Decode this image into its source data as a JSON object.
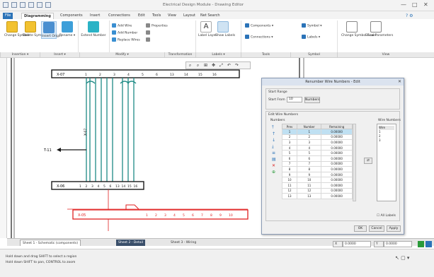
{
  "window": {
    "title": "Electrical Design Module - Drawing Editor",
    "controls": [
      "—",
      "□",
      "✕"
    ]
  },
  "ribbon_tabs": [
    {
      "label": "File"
    },
    {
      "label": "Diagramming",
      "active": true
    },
    {
      "label": "Components"
    },
    {
      "label": "Insert"
    },
    {
      "label": "Connections"
    },
    {
      "label": "Edit"
    },
    {
      "label": "Tools"
    },
    {
      "label": "View"
    },
    {
      "label": "Layout"
    },
    {
      "label": "Net Search"
    }
  ],
  "ribbon": {
    "groups": [
      {
        "label": "Insertion ▾"
      },
      {
        "label": "Insert ▾"
      },
      {
        "label": "Modify ▾"
      },
      {
        "label": "Transformation"
      },
      {
        "label": "Labels ▾"
      },
      {
        "label": "Tools"
      },
      {
        "label": "Symbol"
      },
      {
        "label": "View"
      }
    ],
    "buttons": {
      "b1": "Change Symbol",
      "b2": "Delete Symbol",
      "b3": "Insert Origin",
      "b4": "Rename ▾",
      "b5": "Extend Number",
      "b6": "Label Layer",
      "b7": "Show Labels",
      "b8": "Change Symbol Scale",
      "b9": "Show Parameters"
    },
    "small": {
      "s1": "Add Wire",
      "s2": "Add Number",
      "s3": "Replace Wires",
      "s4": "Properties",
      "s5": "Components ▾",
      "s6": "Symbol ▾",
      "s7": "Connections ▾",
      "s8": "Labels ▾"
    }
  },
  "diagram": {
    "upper_bus_label": "X-07",
    "lower_bus_label": "X-06",
    "red_bus_label": "X-05",
    "wire_label": "X-07",
    "output_label": "T-11",
    "upper_pins": [
      "1",
      "2",
      "3",
      "4",
      "5",
      "6",
      "13",
      "14",
      "15",
      "16"
    ],
    "lower_pins": [
      "1",
      "2",
      "3",
      "4",
      "5",
      "6",
      "13",
      "14",
      "15",
      "16"
    ],
    "red_pins": [
      "1",
      "2",
      "3",
      "4",
      "5",
      "6",
      "7",
      "8",
      "9",
      "10"
    ]
  },
  "dialog": {
    "title": "Renumber Wire Numbers - Edit",
    "close": "✕",
    "section1": "Start Range",
    "start_from_label": "Start From",
    "start_from_value": "10",
    "numbers_btn": "Numbers",
    "section2": "Edit Wire Numbers",
    "subsection": "Numbers",
    "right_section": "Wire Numbers",
    "columns": [
      "Prev",
      "Number",
      "Remaining"
    ],
    "rows": [
      [
        "1",
        "1",
        "0.00000"
      ],
      [
        "2",
        "2",
        "0.00000"
      ],
      [
        "3",
        "3",
        "0.00000"
      ],
      [
        "4",
        "4",
        "0.00000"
      ],
      [
        "5",
        "5",
        "0.00000"
      ],
      [
        "6",
        "6",
        "0.00000"
      ],
      [
        "7",
        "7",
        "0.00000"
      ],
      [
        "8",
        "8",
        "0.00000"
      ],
      [
        "9",
        "9",
        "0.00000"
      ],
      [
        "10",
        "10",
        "0.00000"
      ],
      [
        "11",
        "11",
        "0.00000"
      ],
      [
        "12",
        "12",
        "0.00000"
      ],
      [
        "13",
        "13",
        "0.00000"
      ]
    ],
    "right_list": [
      "Wire",
      "1",
      "2",
      "3"
    ],
    "checkbox_label": "All Labels",
    "ok": "OK",
    "cancel": "Cancel",
    "apply": "Apply"
  },
  "doc_tabs": [
    {
      "label": "Sheet 1 - Schematic (components)",
      "dark": false,
      "active": true
    },
    {
      "label": "Sheet 2 - Detail",
      "dark": true
    },
    {
      "label": "Sheet 3 - Wiring",
      "dark": false
    }
  ],
  "coords": {
    "x_label": "X",
    "x_value": "0.0000",
    "y_label": "Y",
    "y_value": "0.0000"
  },
  "status": {
    "line1": "Hold down and drag SHIFT to select a region",
    "line2": "Hold down SHIFT to pan, CONTROL to zoom"
  },
  "colors": {
    "accent": "#2b73b8",
    "wire_teal": "#1e8a85",
    "wire_red": "#e02020",
    "bus_black": "#1a1a1a"
  }
}
